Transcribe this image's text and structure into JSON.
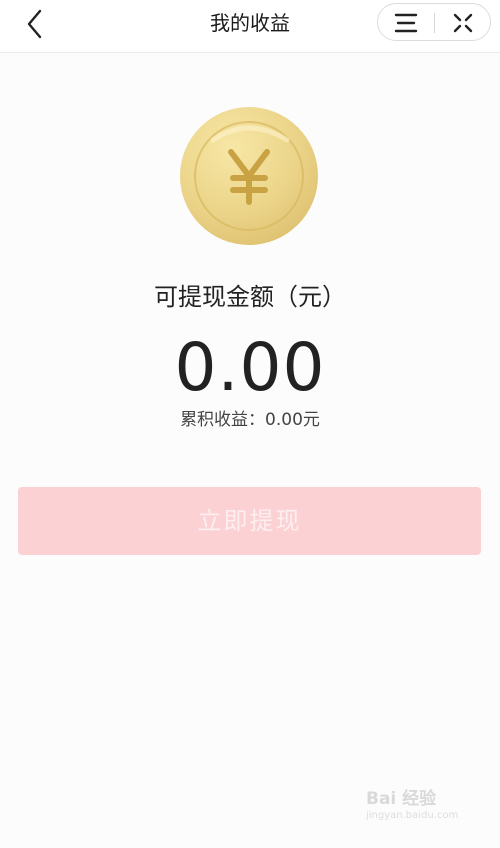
{
  "header": {
    "title": "我的收益",
    "back_icon": "chevron-left-icon",
    "menu_icon": "menu-icon",
    "close_icon": "close-icon"
  },
  "balance": {
    "label": "可提现金额（元）",
    "value": "0.00",
    "accumulated": "累积收益：0.00元"
  },
  "coin": {
    "icon": "yuan-coin-icon",
    "symbol": "¥",
    "color": "#ecd58a"
  },
  "withdraw_button": {
    "label": "立即提现",
    "background": "#fbd1d4"
  },
  "watermark": {
    "text": "Bai 经验",
    "url": "jingyan.baidu.com"
  }
}
